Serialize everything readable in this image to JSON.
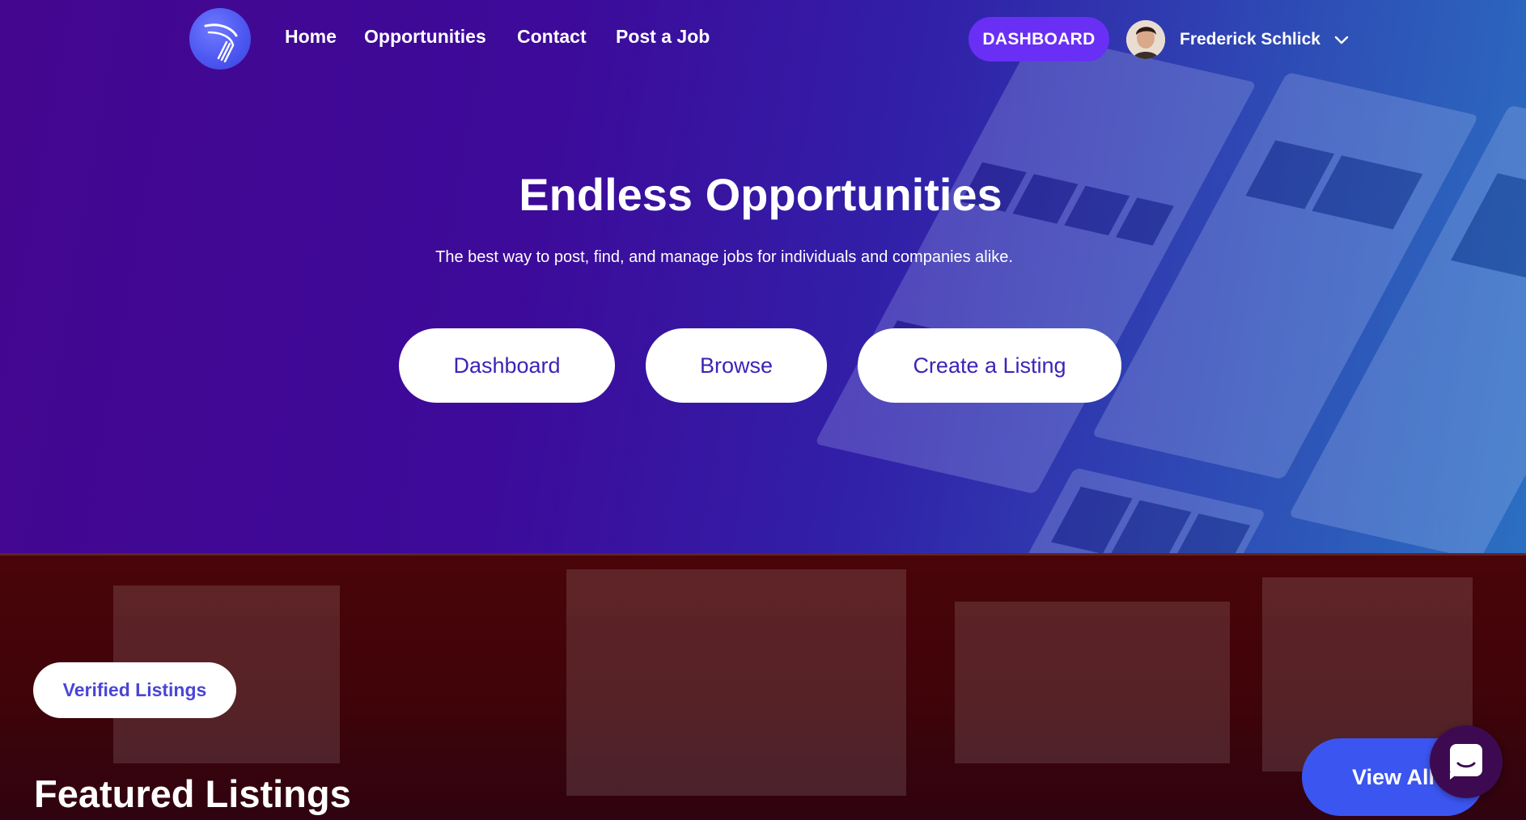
{
  "nav": {
    "links": [
      {
        "label": "Home"
      },
      {
        "label": "Opportunities"
      },
      {
        "label": "Contact"
      },
      {
        "label": "Post a Job"
      }
    ],
    "dashboard_button": "DASHBOARD",
    "user_name": "Frederick Schlick"
  },
  "hero": {
    "title": "Endless Opportunities",
    "subtitle": "The best way to post, find, and manage jobs for individuals and companies alike.",
    "buttons": [
      {
        "label": "Dashboard"
      },
      {
        "label": "Browse"
      },
      {
        "label": "Create a Listing"
      }
    ]
  },
  "featured": {
    "badge": "Verified Listings",
    "title": "Featured Listings",
    "view_all": "View All"
  },
  "colors": {
    "hero_gradient_start": "#44068e",
    "hero_gradient_end": "#2b6fc2",
    "accent": "#6a2ff5",
    "button_text": "#3a25b8",
    "lower_background": "#4a0509",
    "view_all_background": "#3b55f0"
  },
  "icons": {
    "logo": "bird-wing-logo-icon",
    "user_menu": "chevron-down-icon",
    "chat": "chat-bubble-icon"
  }
}
